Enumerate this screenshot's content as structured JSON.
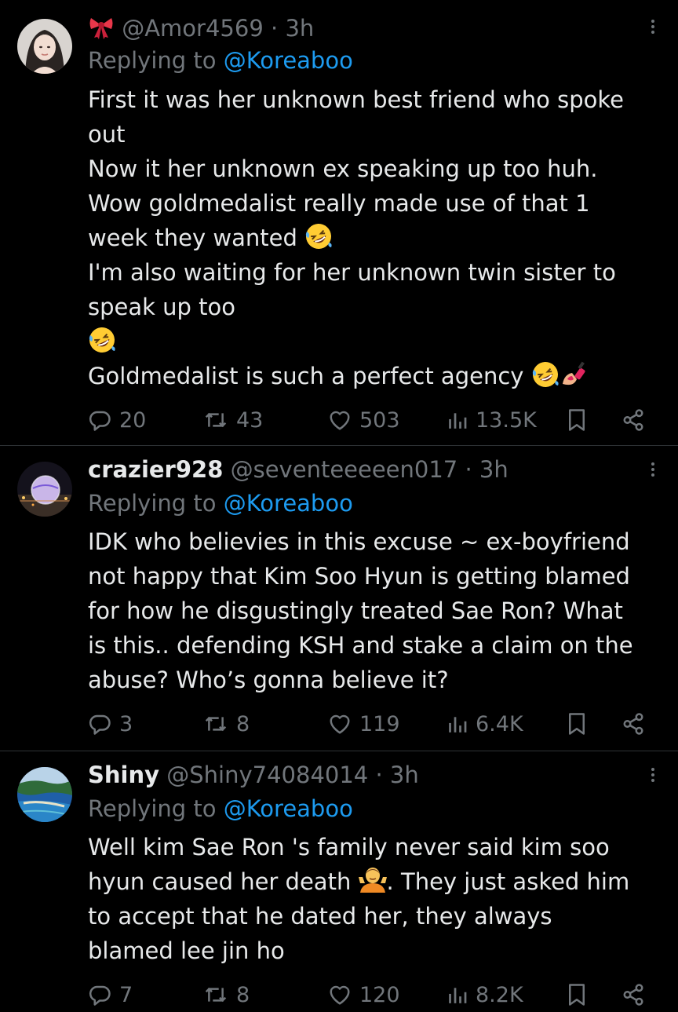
{
  "tweets": [
    {
      "name": "",
      "name_prefix_emoji": "ribbon-emoji",
      "handle": "@Amor4569",
      "time": "3h",
      "sep": "·",
      "replying_label": "Replying to",
      "replying_handle": "@Koreaboo",
      "lines": [
        "First it was her unknown best friend who spoke",
        "out",
        "Now it her unknown ex speaking up too huh.",
        "Wow goldmedalist really made use of that 1",
        "week they wanted",
        "I'm also waiting for her unknown twin sister to",
        "speak up too",
        "",
        "Goldmedalist is such a perfect agency"
      ],
      "emojis": [
        "rolling-on-floor-laughing-emoji",
        "nail-polish-emoji",
        "shrug-emoji"
      ],
      "replies": "20",
      "reposts": "43",
      "likes": "503",
      "views": "13.5K"
    },
    {
      "name": "crazier928",
      "handle": "@seventeeeeen017",
      "time": "3h",
      "sep": "·",
      "replying_label": "Replying to",
      "replying_handle": "@Koreaboo",
      "lines": [
        "IDK who believies in this excuse ~ ex-boyfriend",
        "not happy that Kim Soo Hyun is getting blamed",
        "for how he disgustingly treated Sae Ron? What",
        "is this.. defending KSH and stake a claim on the",
        "abuse? Who’s gonna believe it?"
      ],
      "replies": "3",
      "reposts": "8",
      "likes": "119",
      "views": "6.4K"
    },
    {
      "name": "Shiny",
      "handle": "@Shiny74084014",
      "time": "3h",
      "sep": "·",
      "replying_label": "Replying to",
      "replying_handle": "@Koreaboo",
      "lines": [
        "Well kim Sae Ron 's family never said kim soo",
        "hyun caused her death",
        ". They just asked him",
        "to accept that he dated her, they always",
        "blamed lee jin ho"
      ],
      "replies": "7",
      "reposts": "8",
      "likes": "120",
      "views": "8.2K"
    }
  ],
  "colors": {
    "background": "#000000",
    "text": "#e7e9ea",
    "muted": "#71767b",
    "link": "#1d9bf0",
    "divider": "#2f3336"
  }
}
